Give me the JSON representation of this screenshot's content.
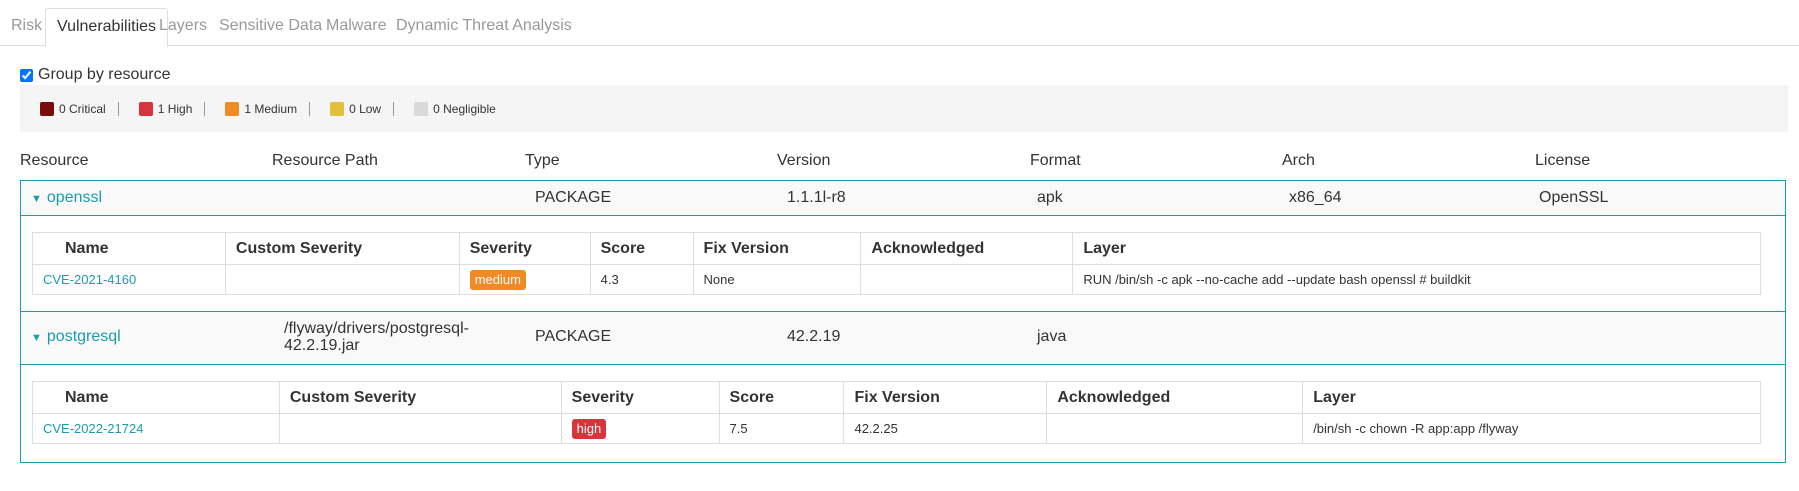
{
  "tabs": [
    "Risk",
    "Vulnerabilities",
    "Layers",
    "Sensitive Data",
    "Malware",
    "Dynamic Threat Analysis"
  ],
  "active_tab": "Vulnerabilities",
  "group_by": {
    "label": "Group by resource",
    "checked": true
  },
  "legend": [
    {
      "label": "0 Critical",
      "color": "#7b0a0a"
    },
    {
      "label": "1 High",
      "color": "#d9343c"
    },
    {
      "label": "1 Medium",
      "color": "#f08a24"
    },
    {
      "label": "0 Low",
      "color": "#e0c13a"
    },
    {
      "label": "0 Negligible",
      "color": "#d9d9d9"
    }
  ],
  "resource_columns": [
    "Resource",
    "Resource Path",
    "Type",
    "Version",
    "Format",
    "Arch",
    "License"
  ],
  "resources": [
    {
      "name": "openssl",
      "path": "",
      "type": "PACKAGE",
      "version": "1.1.1l-r8",
      "format": "apk",
      "arch": "x86_64",
      "license": "OpenSSL",
      "vuln_columns": [
        "Name",
        "Custom Severity",
        "Severity",
        "Score",
        "Fix Version",
        "Acknowledged",
        "Layer"
      ],
      "vulns": [
        {
          "name": "CVE-2021-4160",
          "custom_severity": "",
          "severity": "medium",
          "severity_color": "#f08a24",
          "score": "4.3",
          "fix_version": "None",
          "acknowledged": "",
          "layer": "RUN /bin/sh -c apk --no-cache add --update bash openssl # buildkit"
        }
      ]
    },
    {
      "name": "postgresql",
      "path_line1": "/flyway/drivers/postgresql-",
      "path_line2": "42.2.19.jar",
      "type": "PACKAGE",
      "version": "42.2.19",
      "format": "java",
      "arch": "",
      "license": "",
      "vuln_columns": [
        "Name",
        "Custom Severity",
        "Severity",
        "Score",
        "Fix Version",
        "Acknowledged",
        "Layer"
      ],
      "vulns": [
        {
          "name": "CVE-2022-21724",
          "custom_severity": "",
          "severity": "high",
          "severity_color": "#d9343c",
          "score": "7.5",
          "fix_version": "42.2.25",
          "acknowledged": "",
          "layer": "/bin/sh -c chown -R app:app /flyway"
        }
      ]
    }
  ]
}
